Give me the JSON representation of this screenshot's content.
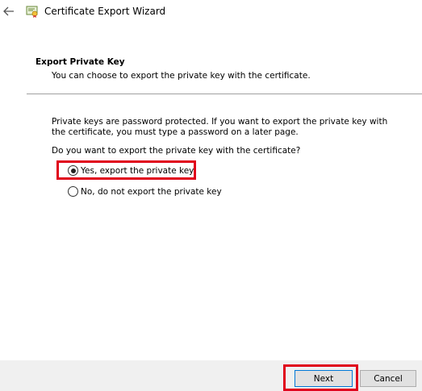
{
  "window": {
    "title": "Certificate Export Wizard",
    "back_icon": "arrow-left-icon",
    "app_icon": "certificate-icon"
  },
  "header": {
    "heading": "Export Private Key",
    "subheading": "You can choose to export the private key with the certificate."
  },
  "body": {
    "description": "Private keys are password protected. If you want to export the private key with the certificate, you must type a password on a later page.",
    "question": "Do you want to export the private key with the certificate?",
    "options": [
      {
        "label": "Yes, export the private key",
        "selected": true
      },
      {
        "label": "No, do not export the private key",
        "selected": false
      }
    ]
  },
  "footer": {
    "next_label": "Next",
    "cancel_label": "Cancel"
  },
  "colors": {
    "highlight": "#e0001b",
    "footer_bg": "#f0f0f0",
    "focus_border": "#0078d7"
  }
}
